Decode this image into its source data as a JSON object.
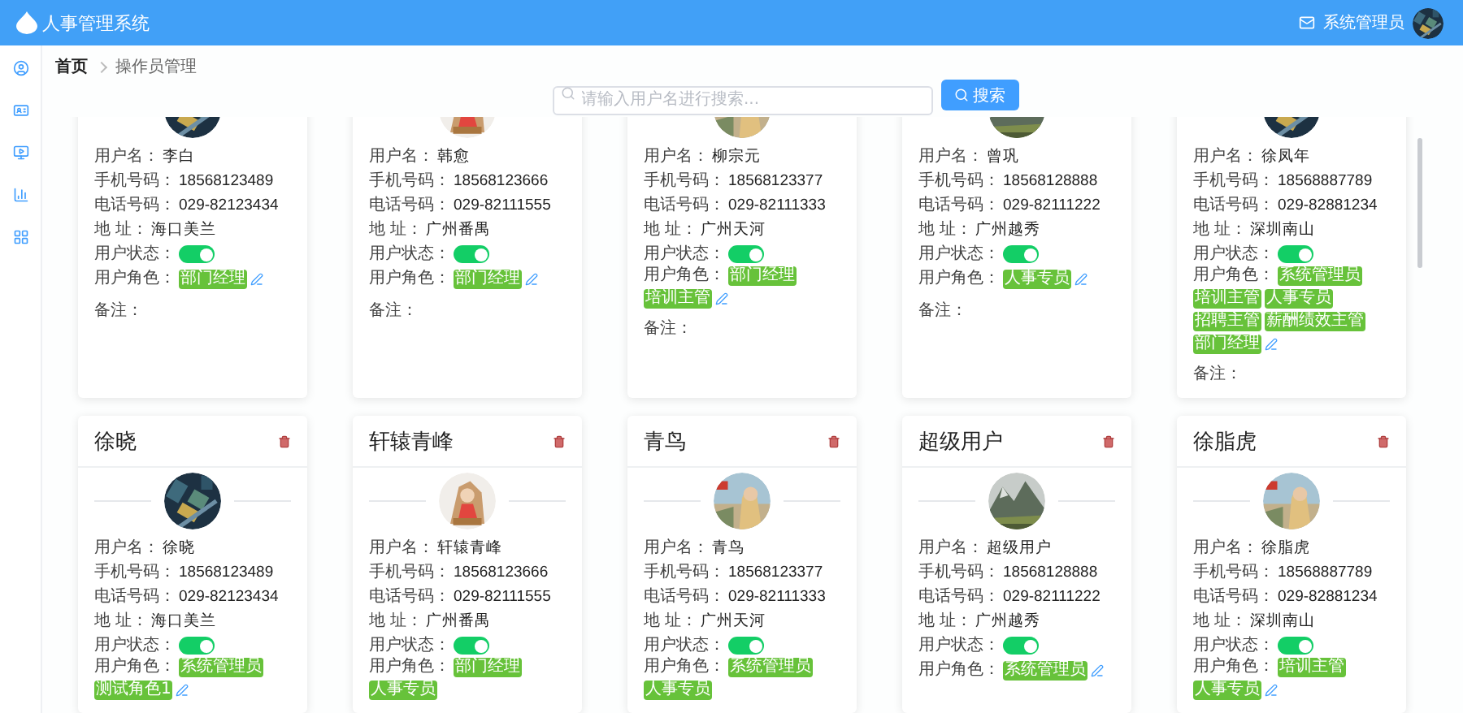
{
  "header": {
    "title": "人事管理系统",
    "user": "系统管理员"
  },
  "breadcrumb": [
    {
      "label": "首页",
      "current": false
    },
    {
      "label": "操作员管理",
      "current": true
    }
  ],
  "search": {
    "placeholder": "请输入用户名进行搜索...",
    "button": "搜索"
  },
  "cards": [
    {
      "fields": [
        {
          "label": "用户名：",
          "value": "李白"
        },
        {
          "label": "手机号码：",
          "value": "18568123489"
        },
        {
          "label": "电话号码：",
          "value": "029-82123434"
        },
        {
          "label": "地 址：",
          "value": "海口美兰"
        }
      ],
      "status_label": "用户状态：",
      "enabled": true,
      "roles_label": "用户角色：",
      "roles": [
        "部门经理"
      ],
      "editable": true,
      "note_label": "备注："
    },
    {
      "fields": [
        {
          "label": "用户名：",
          "value": "韩愈"
        },
        {
          "label": "手机号码：",
          "value": "18568123666"
        },
        {
          "label": "电话号码：",
          "value": "029-82111555"
        },
        {
          "label": "地 址：",
          "value": "广州番禺"
        }
      ],
      "status_label": "用户状态：",
      "enabled": true,
      "roles_label": "用户角色：",
      "roles": [
        "部门经理"
      ],
      "editable": true,
      "note_label": "备注："
    },
    {
      "fields": [
        {
          "label": "用户名：",
          "value": "柳宗元"
        },
        {
          "label": "手机号码：",
          "value": "18568123377"
        },
        {
          "label": "电话号码：",
          "value": "029-82111333"
        },
        {
          "label": "地 址：",
          "value": "广州天河"
        }
      ],
      "status_label": "用户状态：",
      "enabled": true,
      "roles_label": "用户角色：",
      "roles": [
        "部门经理",
        "培训主管"
      ],
      "editable": true,
      "note_label": "备注："
    },
    {
      "fields": [
        {
          "label": "用户名：",
          "value": "曾巩"
        },
        {
          "label": "手机号码：",
          "value": "18568128888"
        },
        {
          "label": "电话号码：",
          "value": "029-82111222"
        },
        {
          "label": "地 址：",
          "value": "广州越秀"
        }
      ],
      "status_label": "用户状态：",
      "enabled": true,
      "roles_label": "用户角色：",
      "roles": [
        "人事专员"
      ],
      "editable": true,
      "note_label": "备注："
    },
    {
      "fields": [
        {
          "label": "用户名：",
          "value": "徐凤年"
        },
        {
          "label": "手机号码：",
          "value": "18568887789"
        },
        {
          "label": "电话号码：",
          "value": "029-82881234"
        },
        {
          "label": "地 址：",
          "value": "深圳南山"
        }
      ],
      "status_label": "用户状态：",
      "enabled": true,
      "roles_label": "用户角色：",
      "roles": [
        "系统管理员",
        "培训主管",
        "人事专员",
        "招聘主管",
        "薪酬绩效主管",
        "部门经理"
      ],
      "editable": true,
      "note_label": "备注："
    },
    {
      "title": "徐晓",
      "fields": [
        {
          "label": "用户名：",
          "value": "徐晓"
        },
        {
          "label": "手机号码：",
          "value": "18568123489"
        },
        {
          "label": "电话号码：",
          "value": "029-82123434"
        },
        {
          "label": "地 址：",
          "value": "海口美兰"
        }
      ],
      "status_label": "用户状态：",
      "enabled": true,
      "roles_label": "用户角色：",
      "roles": [
        "系统管理员",
        "测试角色1"
      ],
      "editable": true
    },
    {
      "title": "轩辕青峰",
      "fields": [
        {
          "label": "用户名：",
          "value": "轩辕青峰"
        },
        {
          "label": "手机号码：",
          "value": "18568123666"
        },
        {
          "label": "电话号码：",
          "value": "029-82111555"
        },
        {
          "label": "地 址：",
          "value": "广州番禺"
        }
      ],
      "status_label": "用户状态：",
      "enabled": true,
      "roles_label": "用户角色：",
      "roles": [
        "部门经理",
        "人事专员"
      ],
      "editable": false
    },
    {
      "title": "青鸟",
      "fields": [
        {
          "label": "用户名：",
          "value": "青鸟"
        },
        {
          "label": "手机号码：",
          "value": "18568123377"
        },
        {
          "label": "电话号码：",
          "value": "029-82111333"
        },
        {
          "label": "地 址：",
          "value": "广州天河"
        }
      ],
      "status_label": "用户状态：",
      "enabled": true,
      "roles_label": "用户角色：",
      "roles": [
        "系统管理员",
        "人事专员"
      ],
      "editable": false
    },
    {
      "title": "超级用户",
      "fields": [
        {
          "label": "用户名：",
          "value": "超级用户"
        },
        {
          "label": "手机号码：",
          "value": "18568128888"
        },
        {
          "label": "电话号码：",
          "value": "029-82111222"
        },
        {
          "label": "地 址：",
          "value": "广州越秀"
        }
      ],
      "status_label": "用户状态：",
      "enabled": true,
      "roles_label": "用户角色：",
      "roles": [
        "系统管理员"
      ],
      "editable": true
    },
    {
      "title": "徐脂虎",
      "fields": [
        {
          "label": "用户名：",
          "value": "徐脂虎"
        },
        {
          "label": "手机号码：",
          "value": "18568887789"
        },
        {
          "label": "电话号码：",
          "value": "029-82881234"
        },
        {
          "label": "地 址：",
          "value": "深圳南山"
        }
      ],
      "status_label": "用户状态：",
      "enabled": true,
      "roles_label": "用户角色：",
      "roles": [
        "培训主管",
        "人事专员"
      ],
      "editable": true
    }
  ]
}
